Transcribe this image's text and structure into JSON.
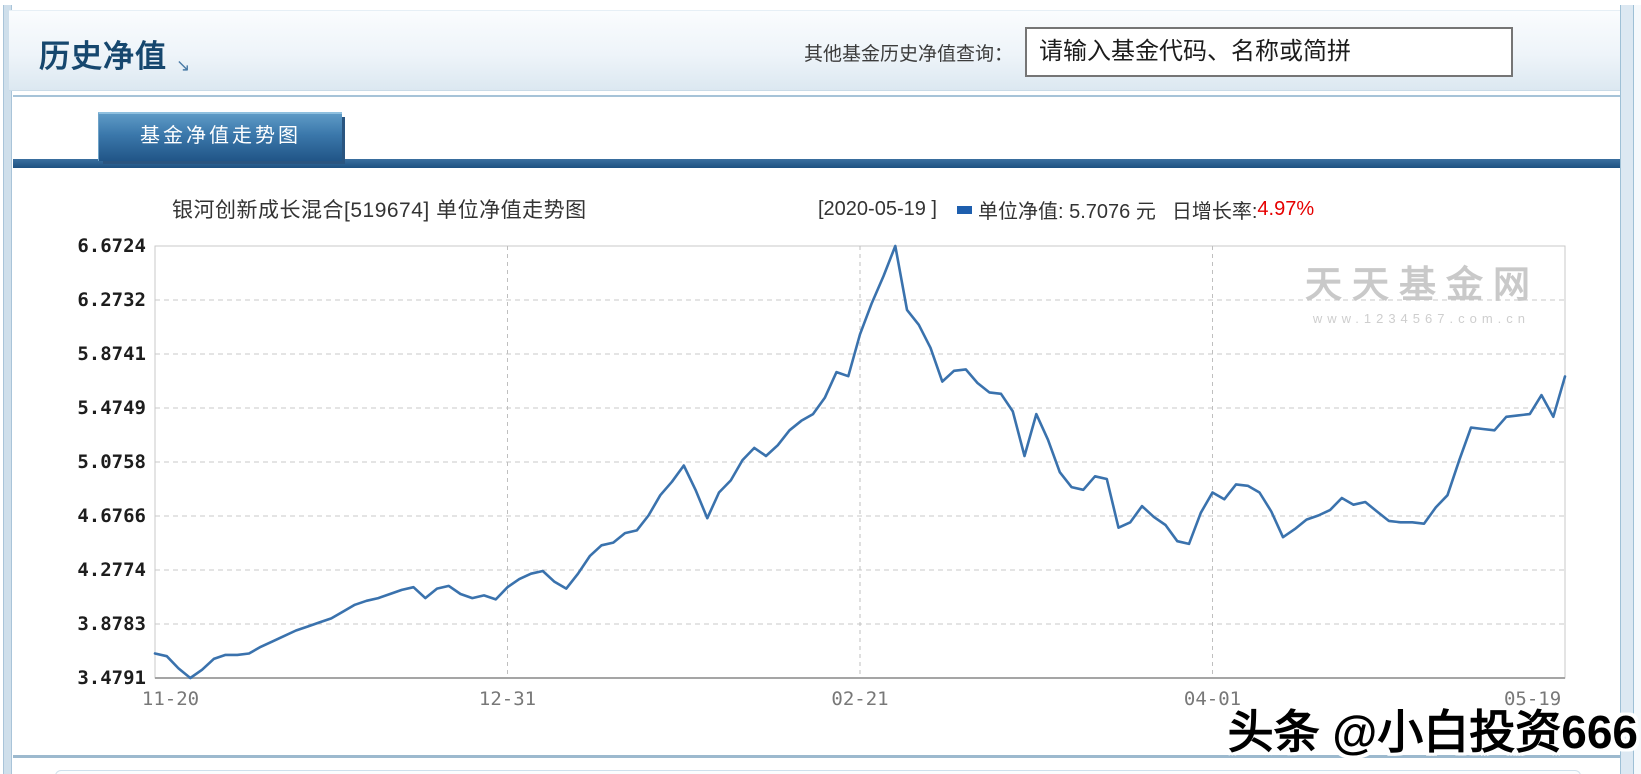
{
  "header": {
    "title": "历史净值",
    "arrow": "↘"
  },
  "search": {
    "label": "其他基金历史净值查询：",
    "placeholder": "请输入基金代码、名称或简拼"
  },
  "tabs": {
    "active": "基金净值走势图"
  },
  "chart_header": {
    "title": "银河创新成长混合[519674] 单位净值走势图",
    "date": "[2020-05-19 ]",
    "unit_text": "单位净值: 5.7076 元",
    "growth_label": "日增长率:",
    "growth_value": "4.97%"
  },
  "watermark": {
    "site": "天天基金网",
    "url": "www.1234567.com.cn"
  },
  "credit": {
    "text": "头条 @小白投资666"
  },
  "colors": {
    "line": "#3a72ad",
    "growth_red": "#e60000",
    "legend_marker": "#1e5fae",
    "title_navy": "#16476e",
    "tab_blue": "#2a6496",
    "watermark_gray": "#c9c9c9",
    "grid_gray": "#c8c8c8"
  },
  "chart_data": {
    "type": "line",
    "title": "银河创新成长混合[519674] 单位净值走势图",
    "series_name": "单位净值",
    "last_date": "2020-05-19",
    "last_value": 5.7076,
    "daily_growth": "4.97%",
    "ylim": [
      3.4791,
      6.6724
    ],
    "y_ticks": [
      6.6724,
      6.2732,
      5.8741,
      5.4749,
      5.0758,
      4.6766,
      4.2774,
      3.8783,
      3.4791
    ],
    "x_tick_labels": [
      "11-20",
      "12-31",
      "02-21",
      "04-01",
      "05-19"
    ],
    "x_tick_fractions": [
      0.011,
      0.25,
      0.5,
      0.75,
      0.977
    ],
    "grid": "dashed",
    "legend_position": "top-right",
    "values": [
      3.66,
      3.64,
      3.55,
      3.4791,
      3.54,
      3.62,
      3.65,
      3.65,
      3.66,
      3.71,
      3.75,
      3.79,
      3.83,
      3.86,
      3.89,
      3.92,
      3.97,
      4.02,
      4.05,
      4.07,
      4.1,
      4.13,
      4.15,
      4.07,
      4.14,
      4.16,
      4.1,
      4.07,
      4.09,
      4.06,
      4.15,
      4.21,
      4.25,
      4.27,
      4.19,
      4.14,
      4.25,
      4.38,
      4.46,
      4.48,
      4.55,
      4.57,
      4.68,
      4.83,
      4.93,
      5.05,
      4.87,
      4.66,
      4.85,
      4.94,
      5.09,
      5.18,
      5.12,
      5.2,
      5.31,
      5.38,
      5.43,
      5.55,
      5.74,
      5.71,
      6.02,
      6.25,
      6.45,
      6.6724,
      6.2,
      6.09,
      5.92,
      5.67,
      5.75,
      5.76,
      5.66,
      5.59,
      5.58,
      5.45,
      5.12,
      5.43,
      5.24,
      5.0,
      4.89,
      4.87,
      4.97,
      4.95,
      4.59,
      4.63,
      4.75,
      4.67,
      4.61,
      4.49,
      4.47,
      4.7,
      4.85,
      4.8,
      4.91,
      4.9,
      4.85,
      4.71,
      4.52,
      4.58,
      4.65,
      4.68,
      4.72,
      4.81,
      4.76,
      4.78,
      4.71,
      4.64,
      4.63,
      4.63,
      4.62,
      4.74,
      4.83,
      5.09,
      5.33,
      5.32,
      5.31,
      5.41,
      5.42,
      5.43,
      5.57,
      5.41,
      5.7076
    ]
  }
}
